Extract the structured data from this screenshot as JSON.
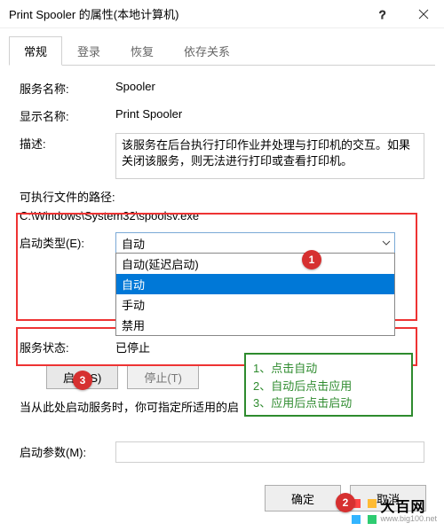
{
  "titlebar": {
    "title": "Print Spooler 的属性(本地计算机)"
  },
  "tabs": [
    "常规",
    "登录",
    "恢复",
    "依存关系"
  ],
  "labels": {
    "service_name": "服务名称:",
    "display_name": "显示名称:",
    "description": "描述:",
    "exe_path": "可执行文件的路径:",
    "startup_type": "启动类型(E):",
    "service_status": "服务状态:",
    "start_params": "启动参数(M):",
    "hint": "当从此处启动服务时，你可指定所适用的启"
  },
  "values": {
    "service_name": "Spooler",
    "display_name": "Print Spooler",
    "description": "该服务在后台执行打印作业并处理与打印机的交互。如果关闭该服务，则无法进行打印或查看打印机。",
    "exe_path": "C:\\Windows\\System32\\spoolsv.exe",
    "startup_selected": "自动",
    "status": "已停止"
  },
  "options": [
    "自动(延迟启动)",
    "自动",
    "手动",
    "禁用"
  ],
  "buttons": {
    "start": "启动(S)",
    "stop": "停止(T)",
    "ok": "确定",
    "cancel": "取消"
  },
  "green_hints": [
    "1、点击自动",
    "2、自动后点击应用",
    "3、应用后点击启动"
  ],
  "watermark": {
    "main": "大百网",
    "sub": "www.big100.net"
  }
}
